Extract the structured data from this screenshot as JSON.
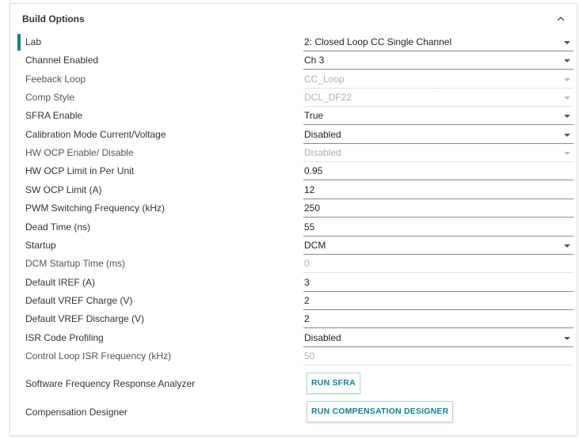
{
  "panel": {
    "title": "Build Options",
    "collapse_icon": "chevron-up-icon"
  },
  "colors": {
    "accent": "#118290"
  },
  "rows": [
    {
      "label": "Lab",
      "value": "2: Closed Loop CC Single Channel",
      "type": "select",
      "disabled": false
    },
    {
      "label": "Channel Enabled",
      "value": "Ch 3",
      "type": "select",
      "disabled": false
    },
    {
      "label": "Feeback Loop",
      "value": "CC_Loop",
      "type": "select",
      "disabled": true
    },
    {
      "label": "Comp Style",
      "value": "DCL_DF22",
      "type": "select",
      "disabled": true
    },
    {
      "label": "SFRA Enable",
      "value": "True",
      "type": "select",
      "disabled": false
    },
    {
      "label": "Calibration Mode Current/Voltage",
      "value": "Disabled",
      "type": "select",
      "disabled": false
    },
    {
      "label": "HW OCP Enable/ Disable",
      "value": "Disabled",
      "type": "select",
      "disabled": true
    },
    {
      "label": "HW OCP Limit in Per Unit",
      "value": "0.95",
      "type": "input",
      "disabled": false
    },
    {
      "label": "SW OCP Limit (A)",
      "value": "12",
      "type": "input",
      "disabled": false
    },
    {
      "label": "PWM Switching Frequency (kHz)",
      "value": "250",
      "type": "input",
      "disabled": false
    },
    {
      "label": "Dead Time (ns)",
      "value": "55",
      "type": "input",
      "disabled": false
    },
    {
      "label": "Startup",
      "value": "DCM",
      "type": "select",
      "disabled": false
    },
    {
      "label": "DCM Startup Time (ms)",
      "value": "0",
      "type": "input",
      "disabled": true
    },
    {
      "label": "Default IREF (A)",
      "value": "3",
      "type": "input",
      "disabled": false
    },
    {
      "label": "Default VREF Charge (V)",
      "value": "2",
      "type": "input",
      "disabled": false
    },
    {
      "label": "Default VREF Discharge (V)",
      "value": "2",
      "type": "input",
      "disabled": false
    },
    {
      "label": "ISR Code Profiling",
      "value": "Disabled",
      "type": "select",
      "disabled": false
    },
    {
      "label": "Control Loop ISR Frequency (kHz)",
      "value": "50",
      "type": "input",
      "disabled": true
    }
  ],
  "actions": [
    {
      "label": "Software Frequency Response Analyzer",
      "button": "RUN SFRA"
    },
    {
      "label": "Compensation Designer",
      "button": "RUN COMPENSATION DESIGNER"
    }
  ]
}
